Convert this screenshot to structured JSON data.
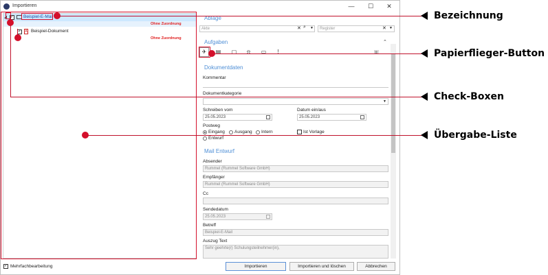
{
  "window": {
    "title": "Importieren",
    "minimize": "—",
    "maximize": "☐",
    "close": "✕"
  },
  "tree": {
    "items": [
      {
        "label": "Beispiel-E-Mail",
        "status": "Ohne Zuordnung"
      },
      {
        "label": "Beispiel-Dokument",
        "status": "Ohne Zuordnung"
      }
    ]
  },
  "ablage": {
    "title": "Ablage",
    "akte_placeholder": "Akte",
    "register_placeholder": "Register"
  },
  "aufgaben": {
    "title": "Aufgaben"
  },
  "dokumentdaten": {
    "title": "Dokumentdaten",
    "kommentar_label": "Kommentar",
    "kategorie_label": "Dokumentkategorie",
    "schreiben_vom_label": "Schreiben vom",
    "schreiben_vom_value": "25.05.2023",
    "datum_label": "Datum ein/aus",
    "datum_value": "25.05.2023",
    "postweg_label": "Postweg",
    "postweg_options": [
      "Eingang",
      "Ausgang",
      "Intern",
      "Entwurf"
    ],
    "postweg_selected": "Eingang",
    "ist_vorlage_label": "Ist Vorlage"
  },
  "mail": {
    "title": "Mail Entwurf",
    "absender_label": "Absender",
    "absender_value": "Rummel (Rummel Software GmbH)",
    "empfaenger_label": "Empfänger",
    "empfaenger_value": "Rummel (Rummel Software GmbH)",
    "cc_label": "Cc",
    "cc_value": "",
    "sendedatum_label": "Sendedatum",
    "sendedatum_value": "25.05.2023",
    "betreff_label": "Betreff",
    "betreff_value": "Beispiel-E-Mail",
    "auszug_label": "Auszug Text",
    "auszug_value": "Sehr geehrte(r) Schulungsteilnehmer(in),"
  },
  "footer": {
    "mehrfach_label": "Mehrfachbearbeitung",
    "importieren": "Importieren",
    "importieren_loeschen": "Importieren und löschen",
    "abbrechen": "Abbrechen"
  },
  "annotations": {
    "bezeichnung": "Bezeichnung",
    "papierflieger": "Papierflieger-Button",
    "checkboxen": "Check-Boxen",
    "uebergabe": "Übergabe-Liste"
  },
  "colors": {
    "annotation": "#d40f2b",
    "section": "#4f8fd6",
    "status": "#e02020",
    "selection": "#cde8ff"
  }
}
